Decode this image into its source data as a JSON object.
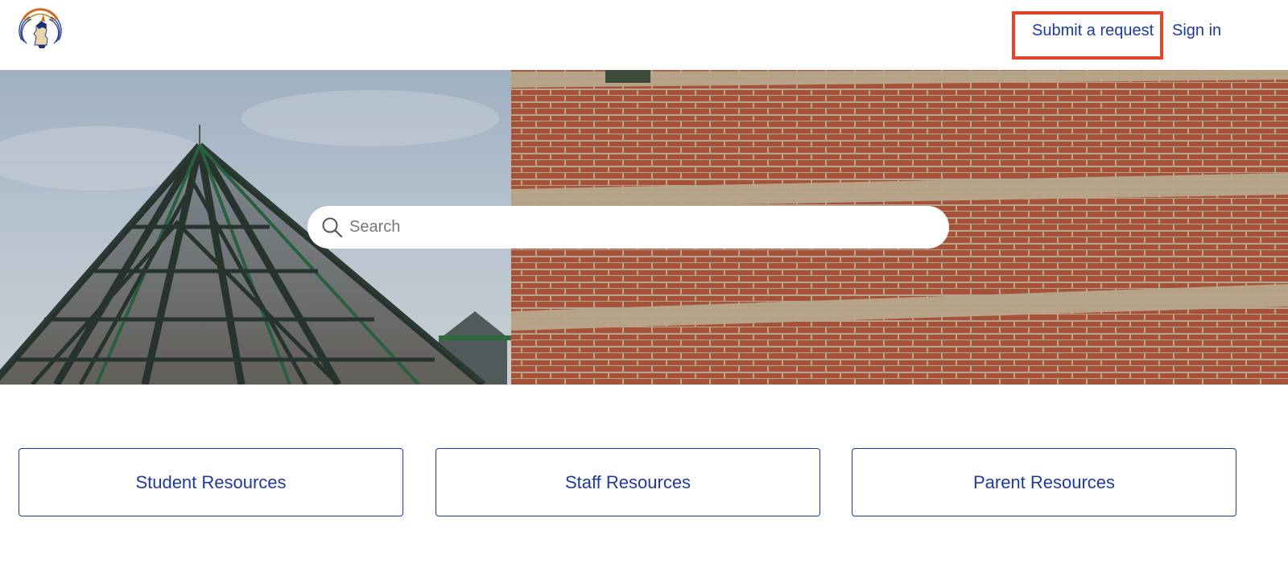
{
  "header": {
    "logo_icon": "indian-mascot-logo-icon",
    "nav": {
      "submit_request": "Submit a request",
      "sign_in": "Sign in"
    },
    "highlight_color": "#e8442a"
  },
  "hero": {
    "image_description_icon": "school-building-pyramid-hero-image",
    "search": {
      "icon": "search-icon",
      "placeholder": "Search",
      "value": ""
    }
  },
  "blocks": [
    {
      "label": "Student Resources"
    },
    {
      "label": "Staff Resources"
    },
    {
      "label": "Parent Resources"
    }
  ],
  "colors": {
    "link": "#1f3a9e",
    "background": "#ffffff"
  }
}
